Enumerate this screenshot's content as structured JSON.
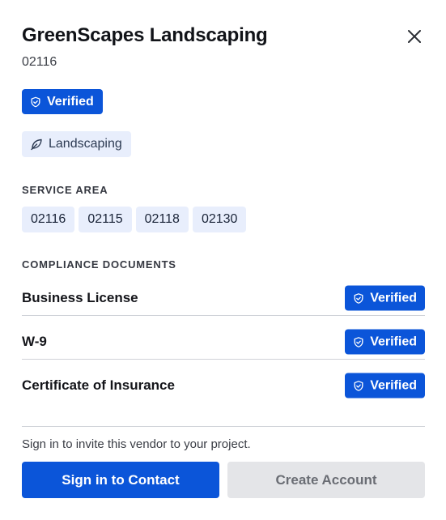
{
  "vendor": {
    "name": "GreenScapes Landscaping",
    "zip": "02116",
    "status_badge": "Verified",
    "category": "Landscaping"
  },
  "service_area": {
    "label": "SERVICE AREA",
    "zips": [
      "02116",
      "02115",
      "02118",
      "02130"
    ]
  },
  "compliance": {
    "label": "COMPLIANCE DOCUMENTS",
    "documents": [
      {
        "name": "Business License",
        "status": "Verified"
      },
      {
        "name": "W-9",
        "status": "Verified"
      },
      {
        "name": "Certificate of Insurance",
        "status": "Verified"
      }
    ]
  },
  "footer": {
    "note": "Sign in to invite this vendor to your project.",
    "primary_button": "Sign in to Contact",
    "secondary_button": "Create Account"
  },
  "colors": {
    "accent": "#0b55d9",
    "chip_bg": "#e8eefc",
    "disabled_bg": "#e4e5e8"
  },
  "icons": {
    "close": "close-icon",
    "verified": "shield-check-icon",
    "category": "leaf-icon"
  }
}
